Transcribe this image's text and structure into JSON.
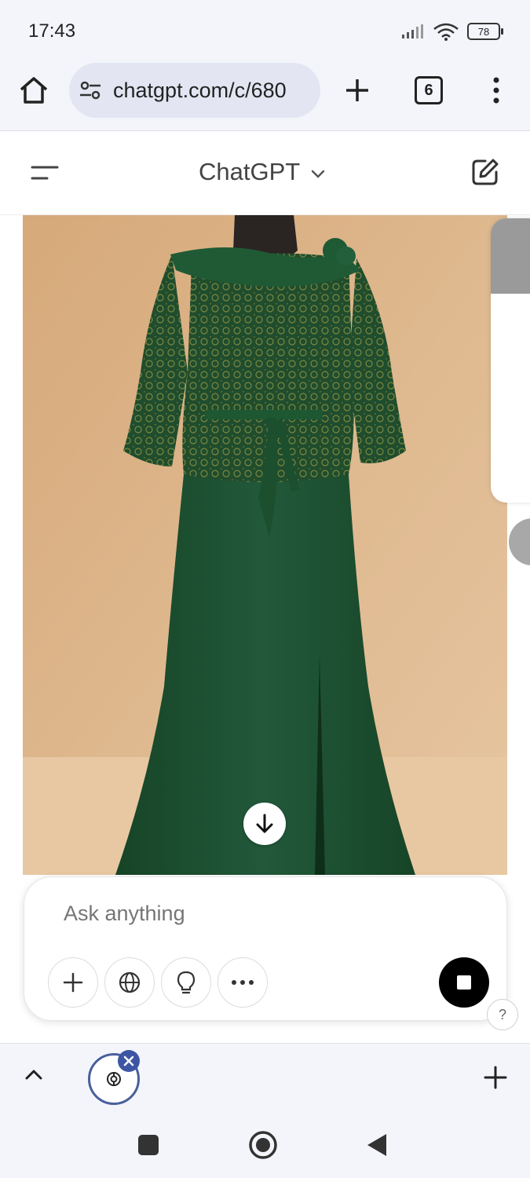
{
  "status_bar": {
    "time": "17:43",
    "battery": "78",
    "icons": [
      "signal-icon",
      "wifi-icon",
      "battery-icon"
    ]
  },
  "browser": {
    "url": "chatgpt.com/c/680",
    "tab_count": "6",
    "icons": [
      "home-icon",
      "tune-icon",
      "plus-icon",
      "tabs-icon",
      "more-vert-icon"
    ]
  },
  "chat": {
    "title": "ChatGPT",
    "icons": [
      "sidebar-icon",
      "chevron-down-icon",
      "new-chat-icon"
    ]
  },
  "content": {
    "image_subject": "green-lace-dress-on-mannequin",
    "colors": {
      "background": "#dcb48c",
      "dress": "#1e5231",
      "lace": "#6f7a3a"
    }
  },
  "composer": {
    "placeholder": "Ask anything",
    "tools": [
      "plus-icon",
      "globe-icon",
      "lightbulb-icon",
      "ellipsis-icon"
    ],
    "stop_icon": "stop-icon"
  },
  "help": {
    "label": "?"
  },
  "tab_strip": {
    "icons": [
      "chevron-up-icon",
      "chatgpt-logo-icon",
      "close-icon",
      "plus-icon"
    ]
  },
  "nav_bar": {
    "icons": [
      "recents-icon",
      "home-icon",
      "back-icon"
    ]
  }
}
